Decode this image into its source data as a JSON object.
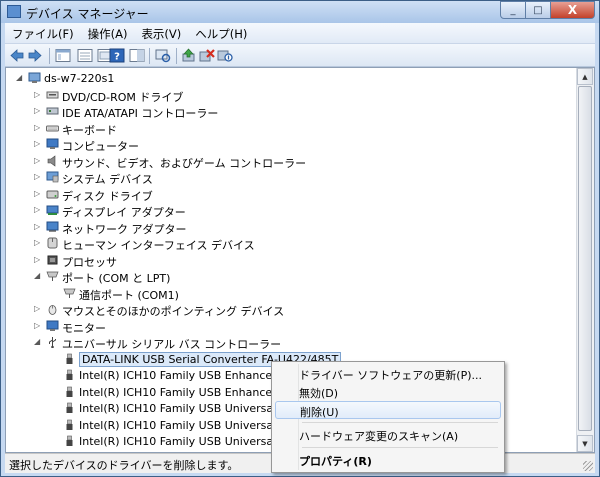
{
  "window": {
    "title": "デバイス マネージャー",
    "close_glyph": "X",
    "max_glyph": "□",
    "min_glyph": "_"
  },
  "menu": [
    "ファイル(F)",
    "操作(A)",
    "表示(V)",
    "ヘルプ(H)"
  ],
  "toolbar": {
    "icons": [
      "back-arrow-icon",
      "forward-arrow-icon",
      "properties-view-icon",
      "hidden-devices-icon",
      "help-icon",
      "show-console-icon",
      "scan-hardware-icon",
      "update-driver-icon",
      "uninstall-icon",
      "disable-icon"
    ]
  },
  "tree": [
    {
      "label": "ds-w7-220s1",
      "level": 0,
      "expanded": true,
      "icon": "computer-icon"
    },
    {
      "label": "DVD/CD-ROM ドライブ",
      "level": 1,
      "expanded": false,
      "icon": "dvd-drive-icon"
    },
    {
      "label": "IDE ATA/ATAPI コントローラー",
      "level": 1,
      "expanded": false,
      "icon": "ide-controller-icon"
    },
    {
      "label": "キーボード",
      "level": 1,
      "expanded": false,
      "icon": "keyboard-icon"
    },
    {
      "label": "コンピューター",
      "level": 1,
      "expanded": false,
      "icon": "monitor-icon"
    },
    {
      "label": "サウンド、ビデオ、およびゲーム コントローラー",
      "level": 1,
      "expanded": false,
      "icon": "speaker-icon"
    },
    {
      "label": "システム デバイス",
      "level": 1,
      "expanded": false,
      "icon": "system-device-icon"
    },
    {
      "label": "ディスク ドライブ",
      "level": 1,
      "expanded": false,
      "icon": "disk-drive-icon"
    },
    {
      "label": "ディスプレイ アダプター",
      "level": 1,
      "expanded": false,
      "icon": "display-adapter-icon"
    },
    {
      "label": "ネットワーク アダプター",
      "level": 1,
      "expanded": false,
      "icon": "network-adapter-icon"
    },
    {
      "label": "ヒューマン インターフェイス デバイス",
      "level": 1,
      "expanded": false,
      "icon": "hid-icon"
    },
    {
      "label": "プロセッサ",
      "level": 1,
      "expanded": false,
      "icon": "processor-icon"
    },
    {
      "label": "ポート (COM と LPT)",
      "level": 1,
      "expanded": true,
      "icon": "port-icon"
    },
    {
      "label": "通信ポート (COM1)",
      "level": 2,
      "icon": "port-icon"
    },
    {
      "label": "マウスとそのほかのポインティング デバイス",
      "level": 1,
      "expanded": false,
      "icon": "mouse-icon"
    },
    {
      "label": "モニター",
      "level": 1,
      "expanded": false,
      "icon": "monitor-icon"
    },
    {
      "label": "ユニバーサル シリアル バス コントローラー",
      "level": 1,
      "expanded": true,
      "icon": "usb-icon"
    },
    {
      "label": "DATA-LINK USB Serial Converter FA-U422/485T",
      "level": 2,
      "icon": "usb-plug-icon",
      "selected": true
    },
    {
      "label": "Intel(R) ICH10 Family USB Enhanced Ho",
      "level": 2,
      "icon": "usb-plug-icon"
    },
    {
      "label": "Intel(R) ICH10 Family USB Enhanced Ho",
      "level": 2,
      "icon": "usb-plug-icon"
    },
    {
      "label": "Intel(R) ICH10 Family USB Universal Ho",
      "level": 2,
      "icon": "usb-plug-icon"
    },
    {
      "label": "Intel(R) ICH10 Family USB Universal Ho",
      "level": 2,
      "icon": "usb-plug-icon"
    },
    {
      "label": "Intel(R) ICH10 Family USB Universal Ho",
      "level": 2,
      "icon": "usb-plug-icon"
    }
  ],
  "context_menu": [
    {
      "label": "ドライバー ソフトウェアの更新(P)...",
      "hover": false,
      "bold": false
    },
    {
      "label": "無効(D)",
      "hover": false,
      "bold": false
    },
    {
      "label": "削除(U)",
      "hover": true,
      "bold": false
    },
    {
      "sep": true
    },
    {
      "label": "ハードウェア変更のスキャン(A)",
      "hover": false,
      "bold": false
    },
    {
      "sep": true
    },
    {
      "label": "プロパティ(R)",
      "hover": false,
      "bold": true
    }
  ],
  "status": "選択したデバイスのドライバーを削除します。",
  "colors": {
    "accent": "#3c5f87",
    "selection": "#dbe9f9",
    "selection_border": "#7da2ce"
  }
}
